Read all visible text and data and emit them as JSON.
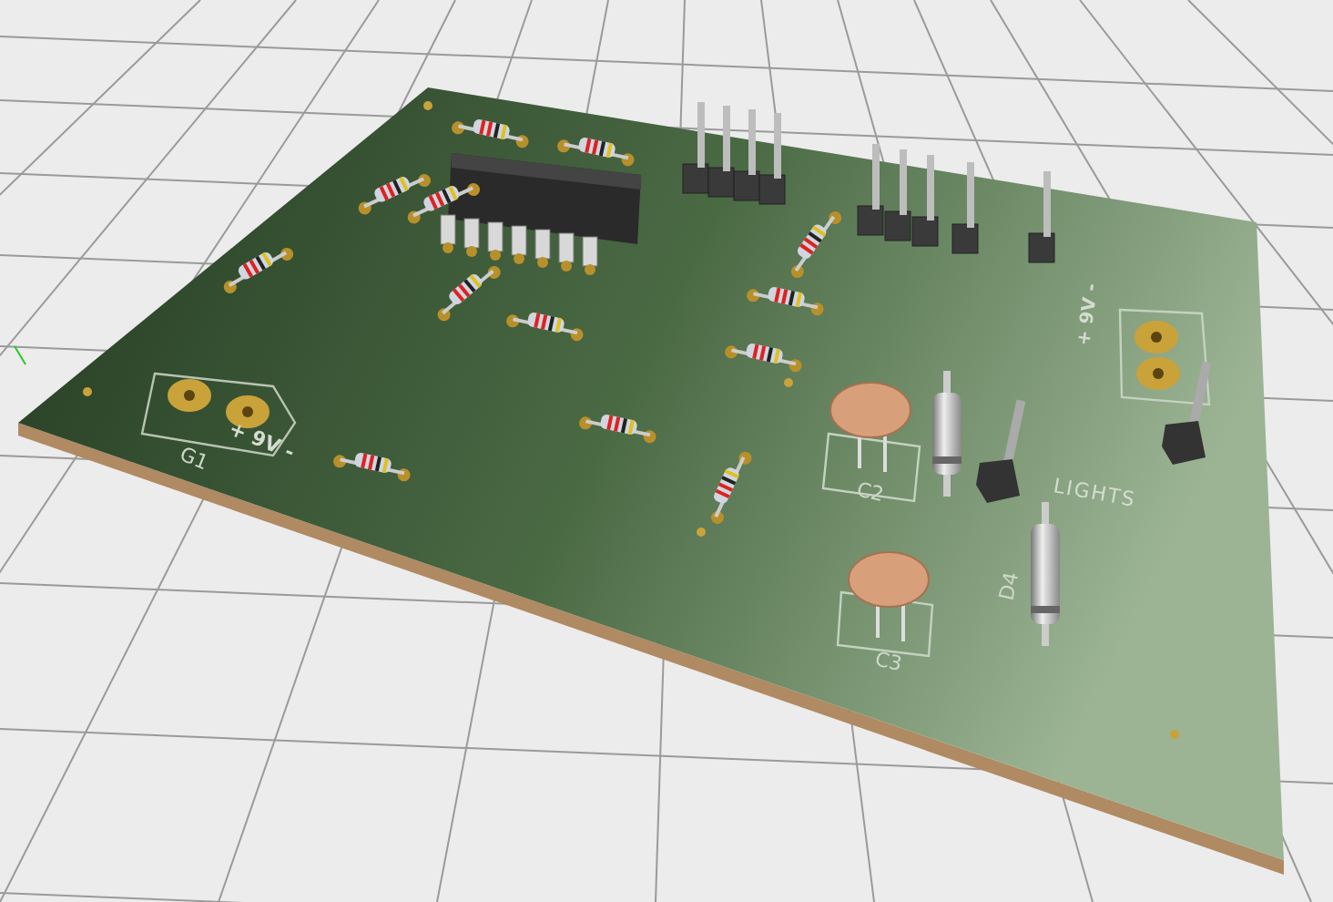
{
  "board": {
    "labels": [
      {
        "kind": "power",
        "text": "+ 9V -"
      },
      {
        "kind": "ref",
        "text": "G1"
      },
      {
        "kind": "ref",
        "text": "C2"
      },
      {
        "kind": "ref",
        "text": "C3"
      },
      {
        "kind": "ref",
        "text": "D4"
      },
      {
        "kind": "name",
        "text": "LIGHTS"
      },
      {
        "kind": "power",
        "text": "+ 9V -"
      }
    ]
  }
}
